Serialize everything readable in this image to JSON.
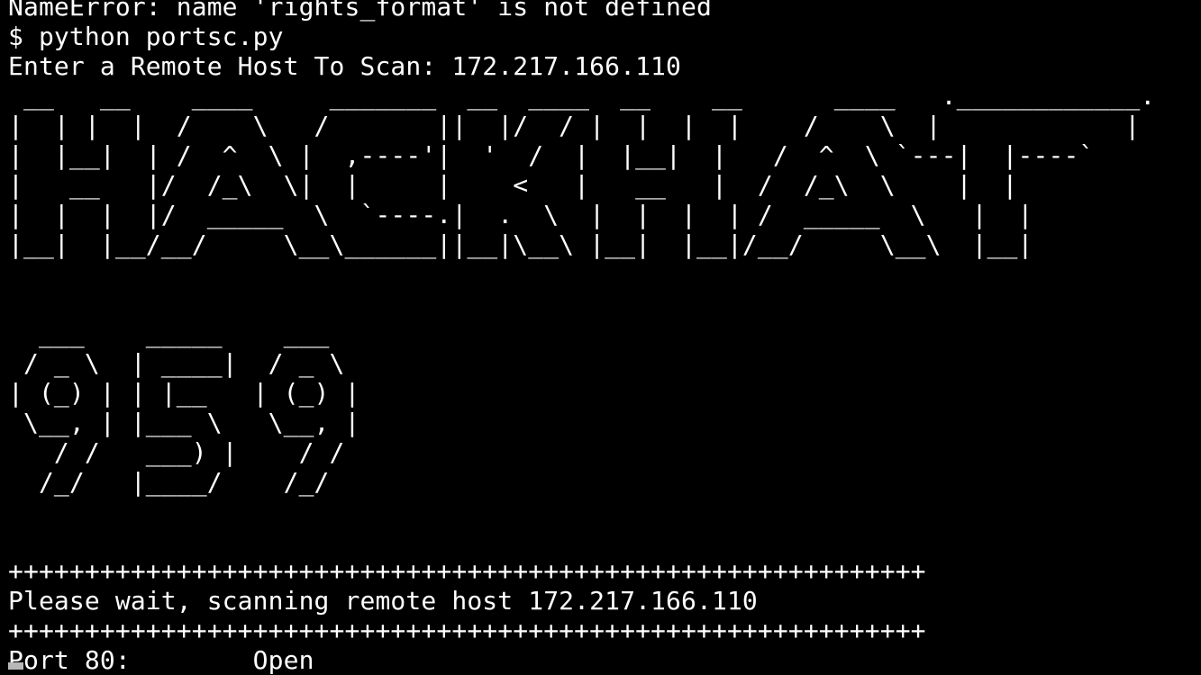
{
  "terminal": {
    "error_line": "NameError: name 'rights_format' is not defined",
    "prompt_line": "$ python portsc.py",
    "input_prompt": "Enter a Remote Host To Scan: 172.217.166.110",
    "banner_title": [
      " __   __    ____     _______  __  ____  __    __      ____   .____________.",
      "|  | |  |  /    \\   /       ||  |/  / |  |  |  |    /    \\  |            |",
      "|  |__|  | /  ^  \\ |  ,----'|  '  /  |  |__|  |   /  ^  \\ `---|  |----`",
      "|   __   |/  /_\\  \\|  |     |    <   |   __   |  /  /_\\  \\    |  |",
      "|  |  |  |/  _____  \\  `----.|  .  \\  |  |  |  | /  _____  \\   |  |",
      "|__|  |__/__/     \\__\\______||__|\\__\\ |__|  |__|/__/     \\__\\  |__|"
    ],
    "banner_number": [
      "  ___    _____    ___",
      " / _ \\  | ____|  / _ \\",
      "| (_) | | |__   | (_) |",
      " \\__, | |___ \\   \\__, |",
      "   / /   ___) |    / /",
      "  /_/   |____/    /_/"
    ],
    "separator_top": "++++++++++++++++++++++++++++++++++++++++++++++++++++++++++++",
    "scan_message": "Please wait, scanning remote host 172.217.166.110",
    "separator_bottom": "++++++++++++++++++++++++++++++++++++++++++++++++++++++++++++",
    "port_line": "Port 80:        Open"
  },
  "colors": {
    "background": "#000000",
    "foreground": "#ffffff",
    "cursor": "#b8b8b8"
  }
}
